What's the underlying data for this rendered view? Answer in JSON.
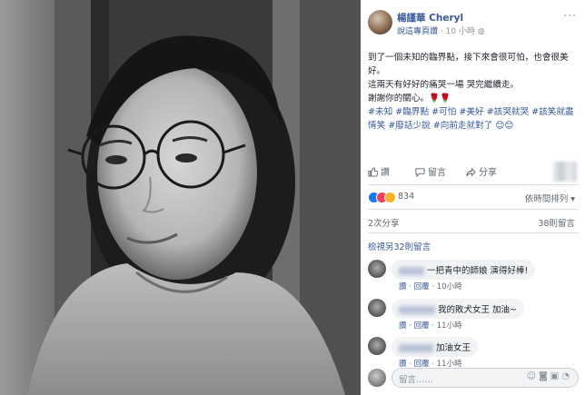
{
  "header": {
    "author_name": "楊謹華 Cheryl",
    "page_link": "說這專頁讚",
    "time": "10 小時",
    "globe_icon": "globe-icon",
    "more_icon": "more-dots-icon"
  },
  "post": {
    "line1": "到了一個未知的臨界點，接下來會很可怕，也會很美好。",
    "line2": "這兩天有好好的痛哭一場 哭完繼續走。",
    "line3": "謝謝你的關心。🌹🌹",
    "tags_line1": "#未知 #臨界點 #可怕 #美好 #該哭就哭 #該笑就盡情笑 #廢話少說 #向前走就對了 😊😊"
  },
  "actions": {
    "like": "讚",
    "comment": "留言",
    "share": "分享"
  },
  "reactions": {
    "count": "834",
    "sort_label": "依時間排列 ▾"
  },
  "stats": {
    "shares": "2次分享",
    "views": "38則留言"
  },
  "more_comments": "檢視另32則留言",
  "comments": [
    {
      "text": "一把青中的師娘 演得好棒!",
      "like": "讚",
      "reply": "回覆",
      "time": "10小時"
    },
    {
      "text": "我的敗犬女王 加油~",
      "like": "讚",
      "reply": "回覆",
      "time": "11小時"
    },
    {
      "text": "加油女王",
      "like": "讚",
      "reply": "回覆",
      "time": "11小時"
    }
  ],
  "composer": {
    "placeholder": "留言……"
  },
  "colors": {
    "link": "#385898",
    "muted": "#90949c",
    "bubble": "#f2f3f5"
  }
}
